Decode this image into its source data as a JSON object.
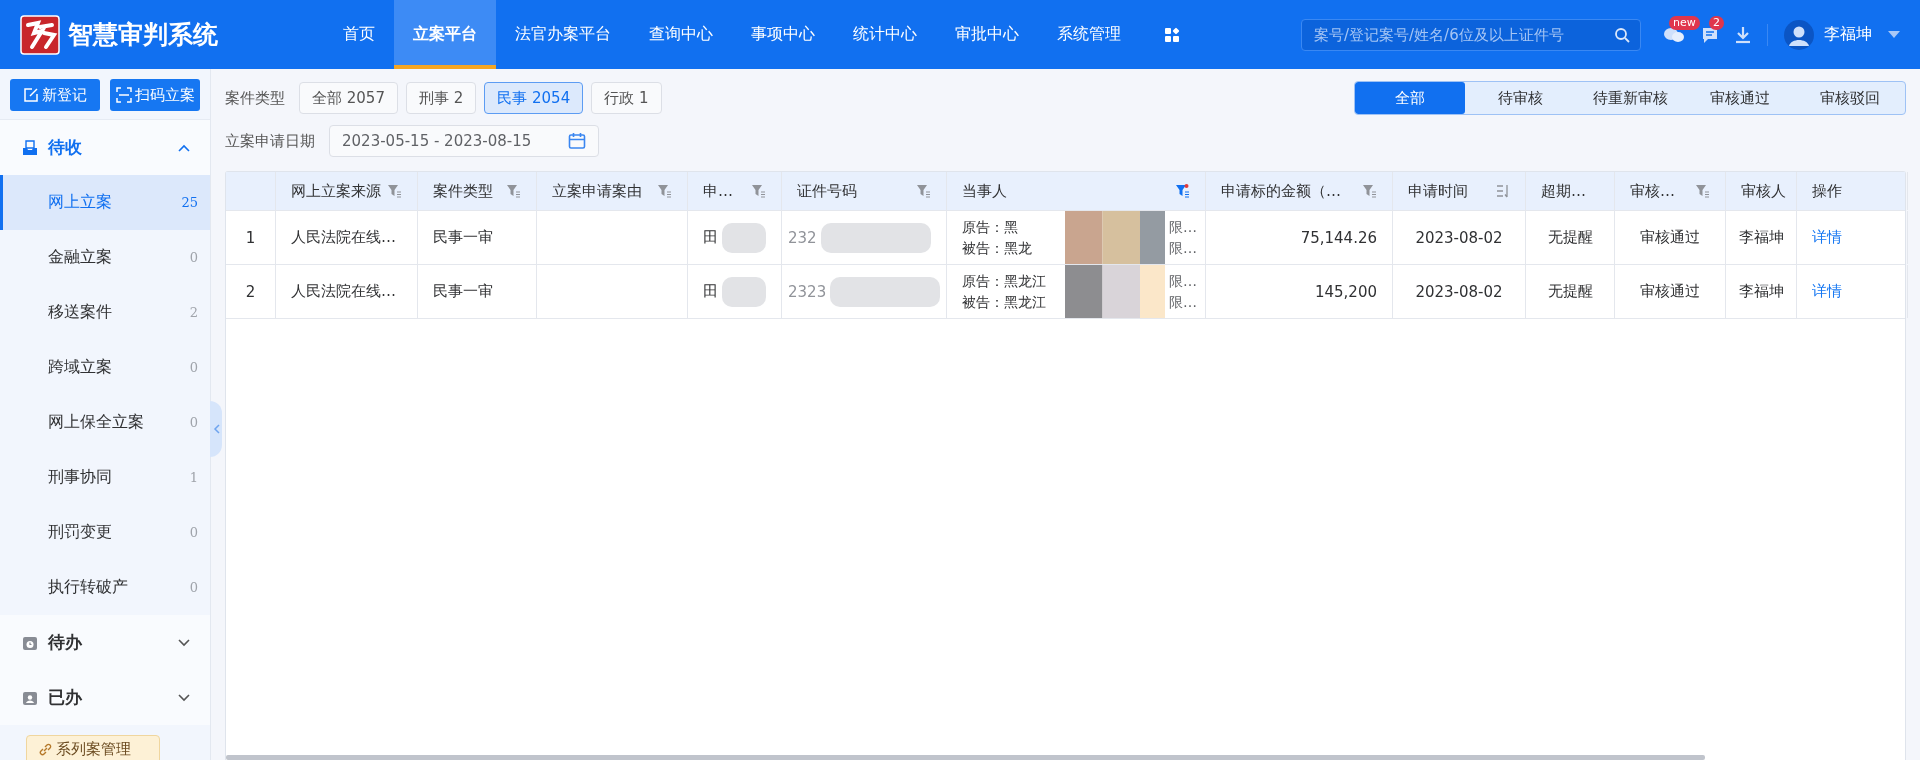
{
  "header": {
    "title": "智慧审判系统",
    "nav": [
      {
        "label": "首页",
        "selected": false
      },
      {
        "label": "立案平台",
        "selected": true
      },
      {
        "label": "法官办案平台",
        "selected": false
      },
      {
        "label": "查询中心",
        "selected": false
      },
      {
        "label": "事项中心",
        "selected": false
      },
      {
        "label": "统计中心",
        "selected": false
      },
      {
        "label": "审批中心",
        "selected": false
      },
      {
        "label": "系统管理",
        "selected": false
      }
    ],
    "search": {
      "placeholder": "案号/登记案号/姓名/6位及以上证件号"
    },
    "chat_badge": "new",
    "message_badge": "2",
    "user": "李福坤"
  },
  "sidebar": {
    "buttons": [
      {
        "label": "新登记",
        "kind": "edit"
      },
      {
        "label": "扫码立案",
        "kind": "scan"
      }
    ],
    "groups": [
      {
        "label": "待收",
        "kind": "inbox",
        "expanded": true,
        "items": [
          {
            "label": "网上立案",
            "count": "25",
            "selected": true
          },
          {
            "label": "金融立案",
            "count": "0",
            "selected": false
          },
          {
            "label": "移送案件",
            "count": "2",
            "selected": false
          },
          {
            "label": "跨域立案",
            "count": "0",
            "selected": false
          },
          {
            "label": "网上保全立案",
            "count": "0",
            "selected": false
          },
          {
            "label": "刑事协同",
            "count": "1",
            "selected": false
          },
          {
            "label": "刑罚变更",
            "count": "0",
            "selected": false
          },
          {
            "label": "执行转破产",
            "count": "0",
            "selected": false
          }
        ]
      },
      {
        "label": "待办",
        "kind": "clock",
        "expanded": false
      },
      {
        "label": "已办",
        "kind": "clipboard",
        "expanded": false
      }
    ],
    "link": "系列案管理"
  },
  "filters": {
    "case_type_label": "案件类型",
    "case_types": [
      {
        "label": "全部",
        "count": "2057",
        "selected": false
      },
      {
        "label": "刑事",
        "count": "2",
        "selected": false
      },
      {
        "label": "民事",
        "count": "2054",
        "selected": true
      },
      {
        "label": "行政",
        "count": "1",
        "selected": false
      }
    ],
    "date_label": "立案申请日期",
    "date_range": "2023-05-15 - 2023-08-15"
  },
  "status_tabs": [
    {
      "label": "全部",
      "selected": true
    },
    {
      "label": "待审核",
      "selected": false
    },
    {
      "label": "待重新审核",
      "selected": false
    },
    {
      "label": "审核通过",
      "selected": false
    },
    {
      "label": "审核驳回",
      "selected": false
    }
  ],
  "table": {
    "columns": [
      {
        "label": "网上立案来源",
        "kind": "filter"
      },
      {
        "label": "案件类型",
        "kind": "filter"
      },
      {
        "label": "立案申请案由",
        "kind": "filter"
      },
      {
        "label": "申…",
        "kind": "filter"
      },
      {
        "label": "证件号码",
        "kind": "filter"
      },
      {
        "label": "当事人",
        "kind": "filtered"
      },
      {
        "label": "申请标的金额（…",
        "kind": "filter"
      },
      {
        "label": "申请时间",
        "kind": "sort"
      },
      {
        "label": "超期…",
        "kind": "plain"
      },
      {
        "label": "审核…",
        "kind": "filter"
      },
      {
        "label": "审核人",
        "kind": "plain"
      },
      {
        "label": "操作",
        "kind": "plain"
      }
    ],
    "rows": [
      {
        "index": "1",
        "source": "人民法院在线…",
        "type": "民事一审",
        "applicant": "田",
        "id_number": "232",
        "parties": [
          {
            "text": "原告：黑",
            "tail": "限…"
          },
          {
            "text": "被告：黑龙",
            "tail": "限…"
          }
        ],
        "amount": "75,144.26",
        "time": "2023-08-02",
        "overdue": "无提醒",
        "status": "审核通过",
        "reviewer": "李福坤",
        "action": "详情"
      },
      {
        "index": "2",
        "source": "人民法院在线…",
        "type": "民事一审",
        "applicant": "田",
        "id_number": "2323",
        "parties": [
          {
            "text": "原告：黑龙江",
            "tail": "限…"
          },
          {
            "text": "被告：黑龙江",
            "tail": "限…"
          }
        ],
        "amount": "145,200",
        "time": "2023-08-02",
        "overdue": "无提醒",
        "status": "审核通过",
        "reviewer": "李福坤",
        "action": "详情"
      }
    ]
  }
}
